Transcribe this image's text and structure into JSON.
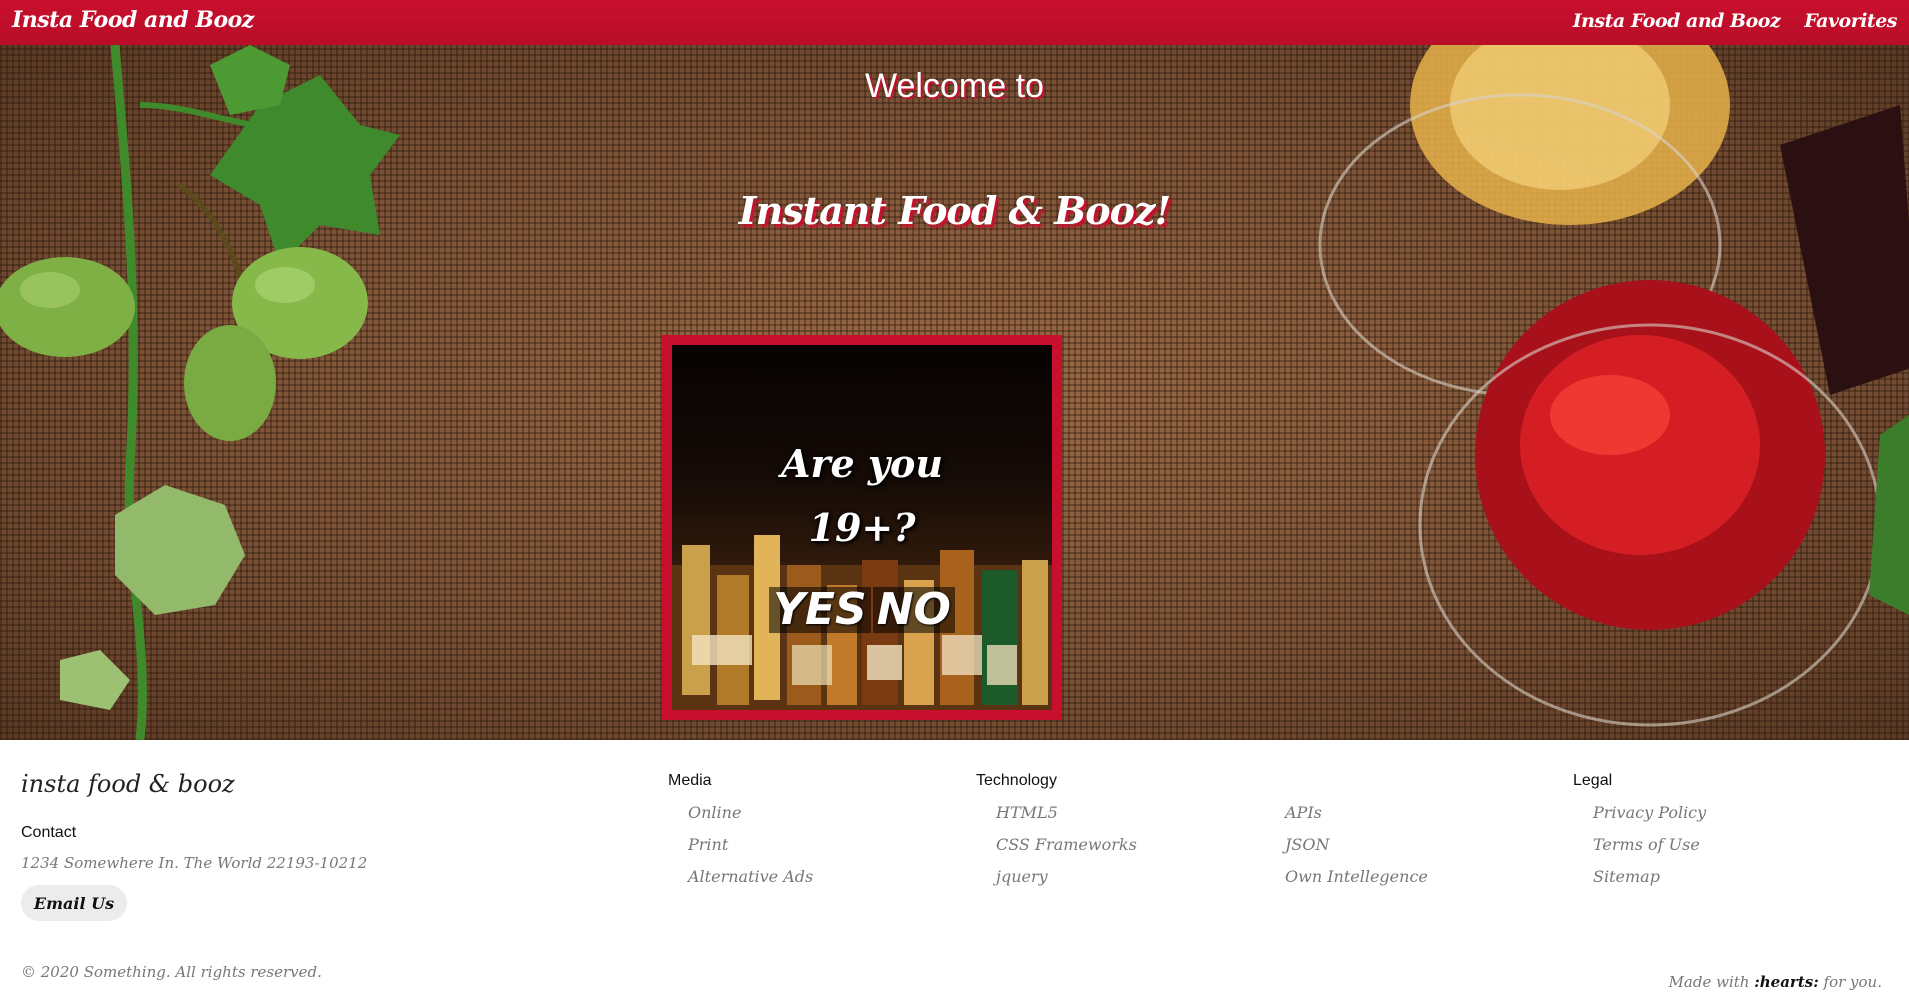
{
  "navbar": {
    "brand": "Insta Food and Booz",
    "links": [
      "Insta Food and Booz",
      "Favorites"
    ]
  },
  "hero": {
    "welcome": "Welcome to",
    "title": "Instant Food & Booz!"
  },
  "age_gate": {
    "question_line1": "Are you",
    "question_line2": "19+?",
    "yes_label": "YES",
    "no_label": "NO"
  },
  "footer": {
    "brand": "insta food & booz",
    "contact_heading": "Contact",
    "address": "1234 Somewhere In. The World 22193-10212",
    "email_button": "Email Us",
    "columns": [
      {
        "heading": "Media",
        "links": [
          "Online",
          "Print",
          "Alternative Ads"
        ]
      },
      {
        "heading": "Technology",
        "links": [
          "HTML5",
          "CSS Frameworks",
          "jquery"
        ]
      },
      {
        "heading": "",
        "links": [
          "APIs",
          "JSON",
          "Own Intellegence"
        ]
      },
      {
        "heading": "Legal",
        "links": [
          "Privacy Policy",
          "Terms of Use",
          "Sitemap"
        ]
      }
    ],
    "copyright": "© 2020 Something. All rights reserved.",
    "made_with_prefix": "Made with",
    "made_with_hearts": ":hearts:",
    "made_with_suffix": "for you."
  },
  "colors": {
    "brand_red": "#c8102e",
    "text_muted": "#777777"
  }
}
